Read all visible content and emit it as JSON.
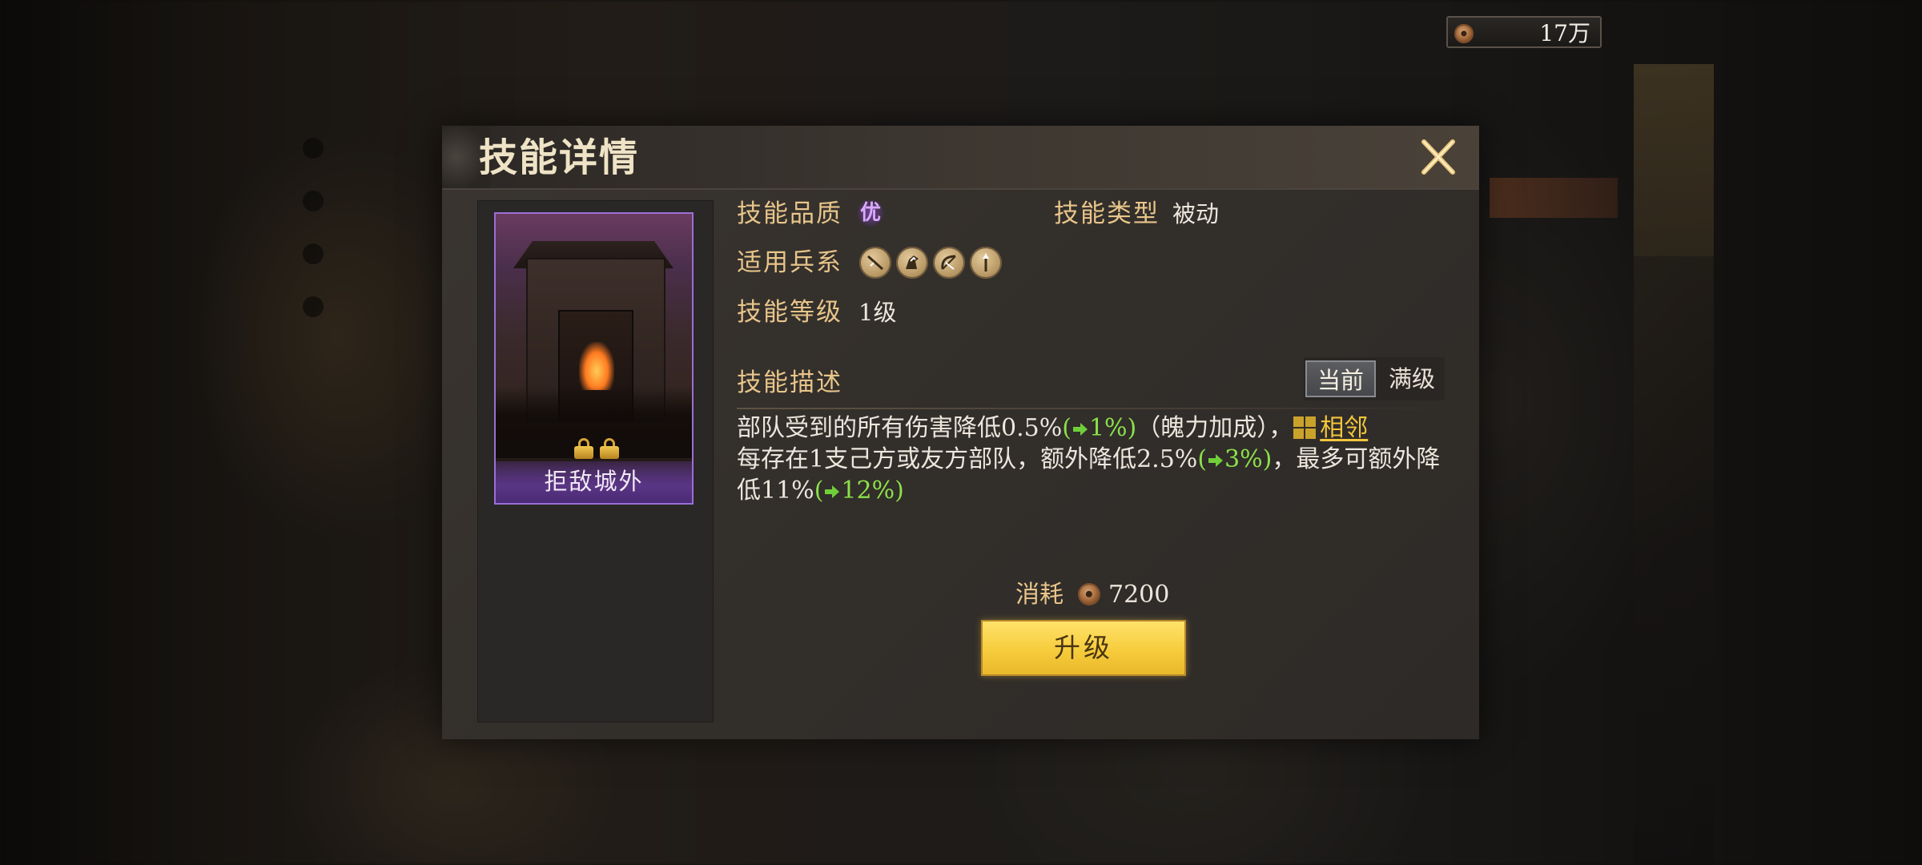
{
  "hud": {
    "currency": {
      "value": "17万",
      "icon": "copper-coin-icon"
    }
  },
  "dialog": {
    "title": "技能详情",
    "close_icon": "close-crossed-swords-icon",
    "card": {
      "name": "拒敌城外",
      "frame_color": "#9a6fd6"
    },
    "quality": {
      "label": "技能品质",
      "value": "优",
      "color": "#d9a8ff"
    },
    "type": {
      "label": "技能类型",
      "value": "被动"
    },
    "troops": {
      "label": "适用兵系",
      "icons": [
        "sword-troop-icon",
        "cavalry-troop-icon",
        "bow-troop-icon",
        "spear-troop-icon"
      ]
    },
    "level": {
      "label": "技能等级",
      "value": "1级"
    },
    "description": {
      "label": "技能描述",
      "toggle": {
        "current": "当前",
        "max": "满级"
      },
      "parts": {
        "p1": "部队受到的所有伤害降低0.5%",
        "p1_open": "(",
        "p1_up": "1%",
        "p1_close": ")",
        "p2": "（魄力加成），",
        "link": "相邻",
        "p3": "每存在1支己方或友方部队，额外降低2.5%",
        "p3_open": "(",
        "p3_up": "3%",
        "p3_close": ")",
        "p4": "，最多可额外降低11%",
        "p4_open": "(",
        "p4_up": "12%",
        "p4_close": ")"
      },
      "colors": {
        "bonus": "#8be04a",
        "keyword": "#f2c53d"
      }
    },
    "cost": {
      "label": "消耗",
      "value": "7200",
      "icon": "copper-coin-icon"
    },
    "upgrade_button": "升级"
  }
}
